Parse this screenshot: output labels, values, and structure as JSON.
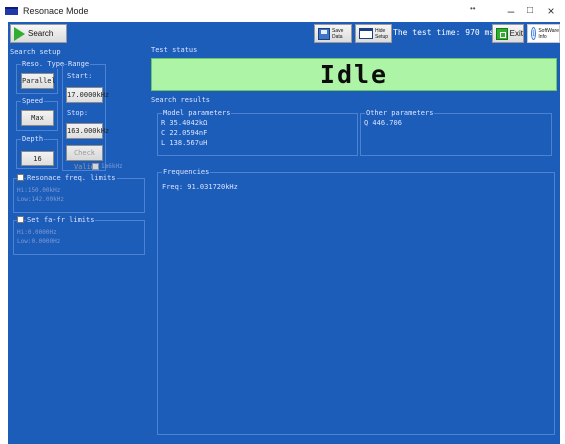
{
  "window": {
    "title": "Resonace Mode",
    "dots": "••",
    "minimize": "–",
    "maximize": "□",
    "close": "×"
  },
  "toolbar": {
    "search_label": "Search",
    "save_label_1": "Save",
    "save_label_2": "Data",
    "hide_label_1": "Hide",
    "hide_label_2": "Setup",
    "test_time": "The test time: 970 ms",
    "exit_label": "Exit",
    "info_label_1": "SoftWare",
    "info_label_2": "Info"
  },
  "search_setup": {
    "title": "Search setup",
    "reso_type": {
      "title": "Reso. Type",
      "value": "Parallel"
    },
    "range": {
      "title": "Range",
      "start_label": "Start:",
      "start_value": "17.0000kHz",
      "stop_label": "Stop:",
      "stop_value": "163.000kHz",
      "check_valid": "Check Valid"
    },
    "speed": {
      "title": "Speed",
      "value": "Max"
    },
    "depth": {
      "title": "Depth",
      "value": "16"
    },
    "sub_label": "1m6kHz",
    "reso_limits": {
      "label": "Resonace freq. limits",
      "hi": "Hi:150.00kHz",
      "low": "Low:142.00kHz"
    },
    "fafr_limits": {
      "label": "Set fa-fr limits",
      "hi": "Hi:0.0000Hz",
      "low": "Low:0.0000Hz"
    }
  },
  "test_status": {
    "title": "Test status",
    "value": "Idle"
  },
  "search_results": {
    "title": "Search results",
    "model": {
      "title": "Model parameters",
      "r": "R  35.4042kΩ",
      "c": "C  22.0594nF",
      "l": "L  138.567uH"
    },
    "other": {
      "title": "Other parameters",
      "q": "Q  446.706"
    },
    "frequencies": {
      "title": "Frequencies",
      "freq": "Freq: 91.031720kHz"
    }
  },
  "colors": {
    "panel": "#1c5dba",
    "status_bg": "#aef4a6",
    "border": "#4d82d2"
  }
}
